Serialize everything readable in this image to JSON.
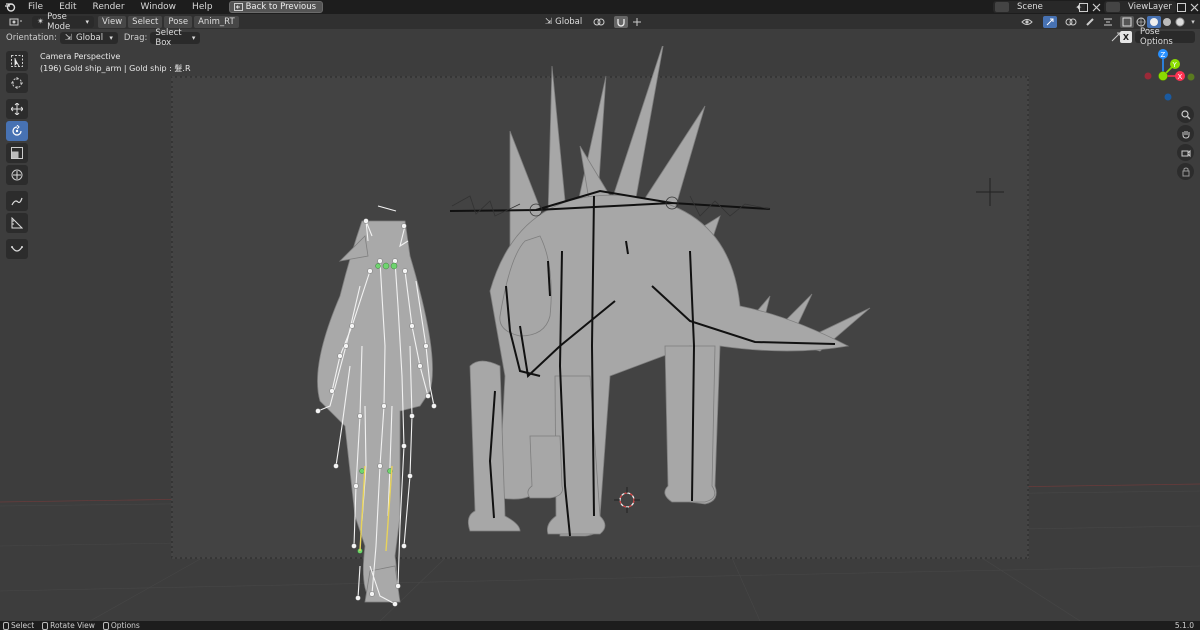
{
  "menubar": {
    "items": [
      "File",
      "Edit",
      "Render",
      "Window",
      "Help"
    ],
    "back_button": "Back to Previous",
    "scene_label": "Scene",
    "view_layer_label": "ViewLayer"
  },
  "header": {
    "mode": "Pose Mode",
    "menus": [
      "View",
      "Select",
      "Pose",
      "Anim_RT"
    ],
    "transform_orientation": "Global",
    "pose_options": "Pose Options",
    "close_x": "X"
  },
  "tool_settings": {
    "orientation_label": "Orientation:",
    "orientation_value": "Global",
    "drag_label": "Drag:",
    "drag_value": "Select Box"
  },
  "viewport": {
    "view_name": "Camera Perspective",
    "object_info": "(196) Gold ship_arm | Gold ship : 髮.R"
  },
  "gizmo": {
    "axes": [
      "X",
      "Y",
      "Z"
    ],
    "colors": {
      "x": "#ff3352",
      "y": "#8bdc00",
      "z": "#2890ff"
    }
  },
  "toolbar": {
    "tools": [
      "select-box",
      "cursor",
      "move",
      "rotate",
      "scale",
      "transform",
      "annotate",
      "measure",
      "relax"
    ]
  },
  "statusbar": {
    "select": "Select",
    "rotate_view": "Rotate View",
    "options": "Options",
    "version": "5.1.0"
  },
  "colors": {
    "accent": "#4772b3",
    "viewport_bg": "#3d3d3d",
    "camera_frame": "#5a5a5a",
    "header_bg": "#303030",
    "topbar_bg": "#1d1d1d"
  }
}
